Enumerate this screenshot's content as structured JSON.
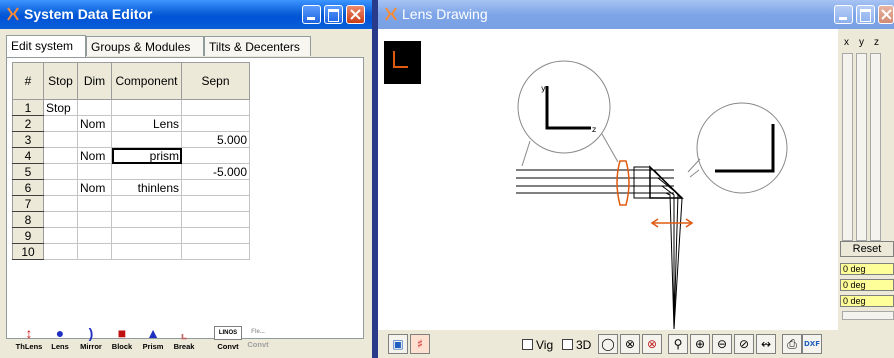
{
  "editor": {
    "title": "System Data Editor",
    "tabs": [
      "Edit system",
      "Groups & Modules",
      "Tilts & Decenters"
    ],
    "columns": [
      "#",
      "Stop",
      "Dim",
      "Component",
      "Sepn"
    ],
    "rows": [
      {
        "n": "1",
        "stop": "Stop",
        "dim": "",
        "comp": "",
        "sepn": ""
      },
      {
        "n": "2",
        "stop": "",
        "dim": "Nom",
        "comp": "Lens",
        "sepn": ""
      },
      {
        "n": "3",
        "stop": "",
        "dim": "",
        "comp": "",
        "sepn": "5.000"
      },
      {
        "n": "4",
        "stop": "",
        "dim": "Nom",
        "comp": "prism",
        "sepn": ""
      },
      {
        "n": "5",
        "stop": "",
        "dim": "",
        "comp": "",
        "sepn": "-5.000"
      },
      {
        "n": "6",
        "stop": "",
        "dim": "Nom",
        "comp": "thinlens",
        "sepn": ""
      },
      {
        "n": "7",
        "stop": "",
        "dim": "",
        "comp": "",
        "sepn": ""
      },
      {
        "n": "8",
        "stop": "",
        "dim": "",
        "comp": "",
        "sepn": ""
      },
      {
        "n": "9",
        "stop": "",
        "dim": "",
        "comp": "",
        "sepn": ""
      },
      {
        "n": "10",
        "stop": "",
        "dim": "",
        "comp": "",
        "sepn": ""
      }
    ],
    "toolbar": [
      "ThLens",
      "Lens",
      "Mirror",
      "Block",
      "Prism",
      "Break"
    ],
    "linos_label": "LINOS",
    "linos_sub": "Fle...",
    "convert_buttons": [
      "Convt",
      "Convt"
    ]
  },
  "drawing": {
    "title": "Lens Drawing",
    "axis_headers": [
      "x",
      "y",
      "z"
    ],
    "reset_label": "Reset",
    "deg_fields": [
      "0 deg",
      "0 deg",
      "0 deg"
    ],
    "vig_label": "Vig",
    "threed_label": "3D",
    "inset_axis_labels": [
      "y",
      "z"
    ],
    "dxf_label": "DXF"
  },
  "colors": {
    "title_blue": "#0a5fd8",
    "orange": "#e05a10",
    "face": "#ece9d8"
  }
}
